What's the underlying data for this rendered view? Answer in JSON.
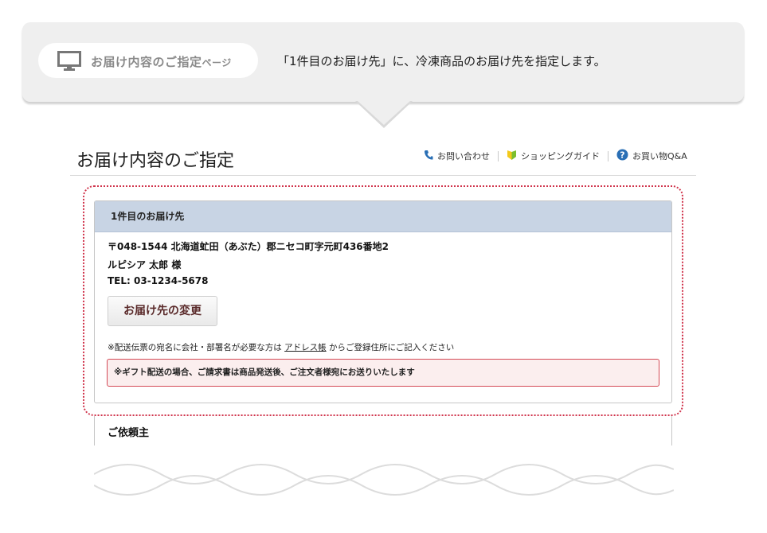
{
  "callout": {
    "page_label": "お届け内容のご指定",
    "page_suffix": "ページ",
    "description": "「1件目のお届け先」に、冷凍商品のお届け先を指定します。"
  },
  "header": {
    "title": "お届け内容のご指定",
    "links": [
      {
        "label": "お問い合わせ",
        "icon": "phone-icon"
      },
      {
        "label": "ショッピングガイド",
        "icon": "beginner-mark-icon"
      },
      {
        "label": "お買い物Q&A",
        "icon": "question-icon"
      }
    ]
  },
  "shipping": {
    "heading": "1件目のお届け先",
    "address": "〒048-1544 北海道虻田（あぶた）郡ニセコ町字元町436番地2",
    "name": "ルピシア 太郎 様",
    "tel": "TEL:  03-1234-5678",
    "change_button": "お届け先の変更",
    "note_before": "※配送伝票の宛名に会社・部署名が必要な方は",
    "note_link": "アドレス帳",
    "note_after": "からご登録住所にご記入ください",
    "gift_notice": "※ギフト配送の場合、ご請求書は商品発送後、ご注文者様宛にお送りいたします"
  },
  "requester": {
    "heading": "ご依頼主"
  },
  "colors": {
    "accent_red": "#d0344c",
    "panel_header": "#c8d4e4",
    "phone": "#2a6fb5",
    "question": "#2a6fb5",
    "leaf_green": "#7cbf2e",
    "leaf_yellow": "#f3c91b"
  }
}
